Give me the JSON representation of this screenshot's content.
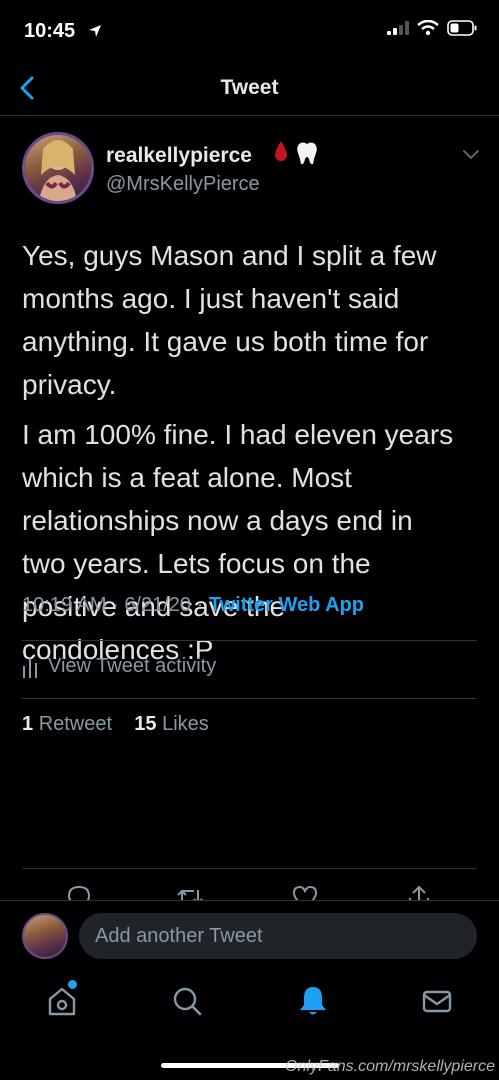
{
  "status_bar": {
    "time": "10:45"
  },
  "nav": {
    "title": "Tweet"
  },
  "tweet": {
    "display_name": "realkellypierce",
    "handle": "@MrsKellyPierce",
    "paragraphs": [
      "Yes, guys Mason and I split a few\nmonths ago. I just haven't said\nanything. It gave us both time for\nprivacy.",
      "I am 100% fine. I had eleven years\nwhich is a feat alone. Most\nrelationships now a days end in\ntwo years. Lets focus on the\npositive and save the\ncondolences :P"
    ],
    "time": "10:19 AM",
    "date": "6/21/20",
    "separator": "·",
    "source": "Twitter Web App"
  },
  "activity": {
    "label": "View Tweet activity"
  },
  "stats": {
    "retweets_count": "1",
    "retweets_label": "Retweet",
    "likes_count": "15",
    "likes_label": "Likes"
  },
  "compose": {
    "placeholder": "Add another Tweet"
  },
  "tabs": [
    "home-icon",
    "search-icon",
    "notifications-icon",
    "messages-icon"
  ],
  "colors": {
    "accent": "#1da1f2",
    "background": "#000000",
    "muted": "#8899a6"
  },
  "watermark": "OnlyFans.com/mrskellypierce"
}
